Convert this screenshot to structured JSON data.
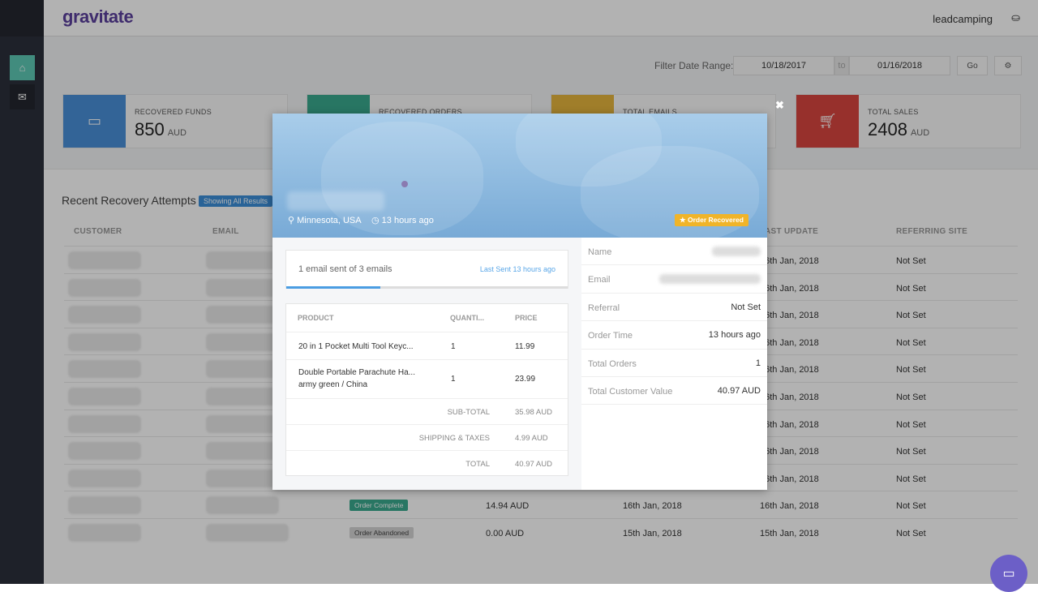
{
  "app": {
    "logo": "gravitate",
    "user": "leadcamping"
  },
  "sidebar": {
    "items": [
      {
        "icon": "home-icon",
        "active": true
      },
      {
        "icon": "envelope-icon",
        "active": false
      }
    ]
  },
  "filter": {
    "label": "Filter Date Range:",
    "from": "10/18/2017",
    "sep": "to",
    "to": "01/16/2018",
    "go": "Go",
    "settings_icon": "gear-icon"
  },
  "cards": [
    {
      "label": "RECOVERED FUNDS",
      "value": "850",
      "unit": "AUD",
      "color": "#4a90d9",
      "icon": "credit-card-icon"
    },
    {
      "label": "RECOVERED ORDERS",
      "color": "#3aaa8f"
    },
    {
      "label": "TOTAL EMAILS",
      "color": "#e5b53d"
    },
    {
      "label": "TOTAL SALES",
      "value": "2408",
      "unit": "AUD",
      "color": "#d9463f",
      "icon": "cart-icon"
    }
  ],
  "recent": {
    "title": "Recent Recovery Attempts -",
    "badge": "Showing All Results",
    "headers": [
      "CUSTOMER",
      "EMAIL",
      "AST UPDATE",
      "REFERRING SITE"
    ],
    "rows": [
      {
        "last_update": "16th Jan, 2018",
        "referring": "Not Set"
      },
      {
        "last_update": "16th Jan, 2018",
        "referring": "Not Set"
      },
      {
        "last_update": "16th Jan, 2018",
        "referring": "Not Set"
      },
      {
        "last_update": "16th Jan, 2018",
        "referring": "Not Set"
      },
      {
        "last_update": "16th Jan, 2018",
        "referring": "Not Set"
      },
      {
        "last_update": "16th Jan, 2018",
        "referring": "Not Set"
      },
      {
        "last_update": "16th Jan, 2018",
        "referring": "Not Set"
      },
      {
        "last_update": "16th Jan, 2018",
        "referring": "Not Set"
      },
      {
        "last_update": "16th Jan, 2018",
        "referring": "Not Set"
      },
      {
        "status": "Order Complete",
        "status_color": "#3aaa8f",
        "value": "14.94 AUD",
        "created": "16th Jan, 2018",
        "last_update": "16th Jan, 2018",
        "referring": "Not Set"
      },
      {
        "status": "Order Abandoned",
        "status_color": "#d5d5d5",
        "value": "0.00 AUD",
        "created": "15th Jan, 2018",
        "last_update": "15th Jan, 2018",
        "referring": "Not Set"
      }
    ]
  },
  "modal": {
    "location": "Minnesota, USA",
    "time": "13 hours ago",
    "badge": "Order Recovered",
    "emails": {
      "text": "1 email sent of 3 emails",
      "last_sent": "Last Sent 13 hours ago",
      "progress": 0.333
    },
    "products": {
      "headers": [
        "PRODUCT",
        "QUANTI...",
        "PRICE"
      ],
      "items": [
        {
          "name": "20 in 1 Pocket Multi Tool Keyc...",
          "variant": "",
          "qty": "1",
          "price": "11.99"
        },
        {
          "name": "Double Portable Parachute Ha...",
          "variant": "army green / China",
          "qty": "1",
          "price": "23.99"
        }
      ],
      "totals": [
        {
          "label": "SUB-TOTAL",
          "value": "35.98 AUD"
        },
        {
          "label": "SHIPPING & TAXES",
          "value": "4.99 AUD"
        },
        {
          "label": "TOTAL",
          "value": "40.97 AUD"
        }
      ]
    },
    "info": [
      {
        "label": "Name",
        "value": null
      },
      {
        "label": "Email",
        "value": null
      },
      {
        "label": "Referral",
        "value": "Not Set"
      },
      {
        "label": "Order Time",
        "value": "13 hours ago"
      },
      {
        "label": "Total Orders",
        "value": "1"
      },
      {
        "label": "Total Customer Value",
        "value": "40.97 AUD"
      }
    ]
  }
}
